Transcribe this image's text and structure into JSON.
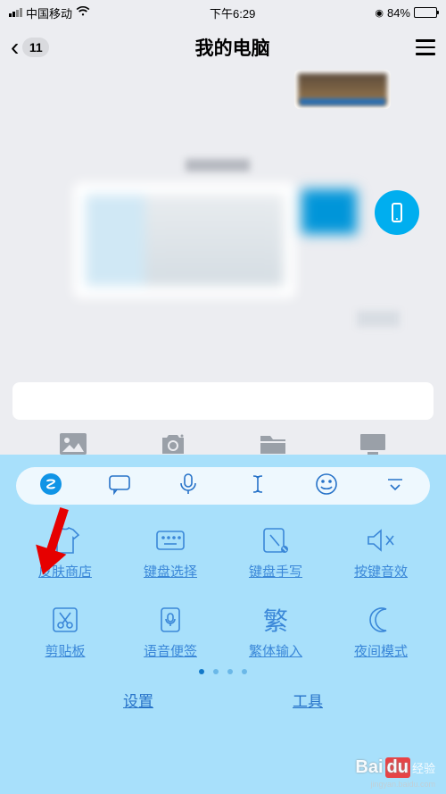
{
  "status": {
    "carrier": "中国移动",
    "time": "下午6:29",
    "battery": "84%",
    "alarm": "⏰"
  },
  "nav": {
    "back_count": "11",
    "title": "我的电脑"
  },
  "keyboard": {
    "grid": [
      {
        "label": "皮肤商店"
      },
      {
        "label": "键盘选择"
      },
      {
        "label": "键盘手写"
      },
      {
        "label": "按键音效"
      },
      {
        "label": "剪贴板"
      },
      {
        "label": "语音便签"
      },
      {
        "label": "繁体输入",
        "glyph": "繁"
      },
      {
        "label": "夜间模式"
      }
    ],
    "bottom": {
      "settings": "设置",
      "tools": "工具"
    }
  },
  "watermark": {
    "brand_left": "Bai",
    "brand_right": "du",
    "cn": "经验",
    "sub": "jingyan.baidu.com"
  }
}
